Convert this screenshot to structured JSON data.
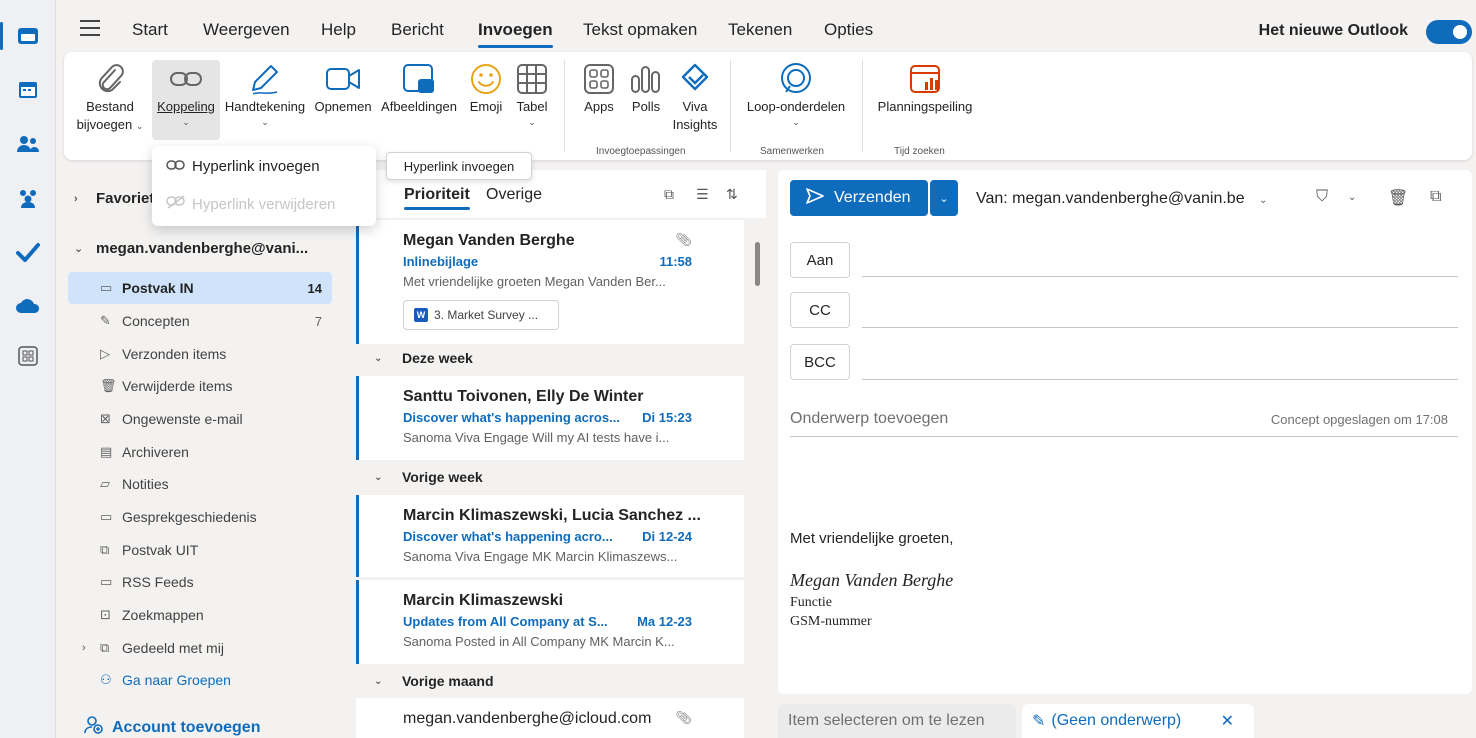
{
  "colors": {
    "accent": "#0f6cbd",
    "selected": "#cfe4fa"
  },
  "menu": {
    "tabs": [
      "Start",
      "Weergeven",
      "Help",
      "Bericht",
      "Invoegen",
      "Tekst opmaken",
      "Tekenen",
      "Opties"
    ],
    "active_tab": "Invoegen",
    "new_outlook_label": "Het nieuwe Outlook"
  },
  "ribbon": {
    "attach": {
      "label1": "Bestand",
      "label2": "bijvoegen",
      "icon": "paperclip-icon"
    },
    "link": {
      "label": "Koppeling",
      "icon": "link-icon"
    },
    "signature": {
      "label": "Handtekening",
      "icon": "pen-icon"
    },
    "record": {
      "label": "Opnemen",
      "icon": "video-icon"
    },
    "images": {
      "label": "Afbeeldingen",
      "icon": "image-icon"
    },
    "emoji": {
      "label": "Emoji",
      "icon": "emoji-icon"
    },
    "table": {
      "label": "Tabel",
      "icon": "table-icon"
    },
    "apps": {
      "label": "Apps",
      "icon": "apps-icon"
    },
    "polls": {
      "label": "Polls",
      "icon": "polls-icon"
    },
    "viva": {
      "label1": "Viva",
      "label2": "Insights",
      "icon": "viva-icon"
    },
    "loop": {
      "label": "Loop-onderdelen",
      "icon": "loop-icon"
    },
    "planning": {
      "label": "Planningspeiling",
      "icon": "calendar-poll-icon"
    },
    "groups": {
      "apps": "Invoegtoepassingen",
      "collab": "Samenwerken",
      "time": "Tijd zoeken"
    }
  },
  "dropdown": {
    "insert_link": "Hyperlink invoegen",
    "remove_link": "Hyperlink verwijderen",
    "tooltip": "Hyperlink invoegen"
  },
  "folders": {
    "favorites": "Favoriet",
    "account": "megan.vandenberghe@vani...",
    "items": [
      {
        "label": "Postvak IN",
        "count": "14"
      },
      {
        "label": "Concepten",
        "count": "7"
      },
      {
        "label": "Verzonden items",
        "count": ""
      },
      {
        "label": "Verwijderde items",
        "count": ""
      },
      {
        "label": "Ongewenste e-mail",
        "count": ""
      },
      {
        "label": "Archiveren",
        "count": ""
      },
      {
        "label": "Notities",
        "count": ""
      },
      {
        "label": "Gesprekgeschiedenis",
        "count": ""
      },
      {
        "label": "Postvak UIT",
        "count": ""
      },
      {
        "label": "RSS Feeds",
        "count": ""
      },
      {
        "label": "Zoekmappen",
        "count": ""
      },
      {
        "label": "Gedeeld met mij",
        "count": ""
      }
    ],
    "groups_link": "Ga naar Groepen",
    "add_account": "Account toevoegen"
  },
  "message_list": {
    "tab_focused": "Prioriteit",
    "tab_other": "Overige",
    "messages": [
      {
        "from": "Megan Vanden Berghe",
        "subject": "Inlinebijlage",
        "time": "11:58",
        "preview": "Met vriendelijke groeten Megan Vanden Ber...",
        "attachment": "3. Market Survey ..."
      },
      {
        "from": "Santtu Toivonen, Elly De Winter",
        "subject": "Discover what's happening acros...",
        "time": "Di 15:23",
        "preview": "Sanoma Viva Engage Will my AI tests have i..."
      },
      {
        "from": "Marcin Klimaszewski, Lucia Sanchez ...",
        "subject": "Discover what's happening acro...",
        "time": "Di 12-24",
        "preview": "Sanoma Viva Engage MK Marcin Klimaszews..."
      },
      {
        "from": "Marcin Klimaszewski",
        "subject": "Updates from All Company at S...",
        "time": "Ma 12-23",
        "preview": "Sanoma Posted in All Company MK Marcin K..."
      },
      {
        "from": "megan.vandenberghe@icloud.com"
      }
    ],
    "sections": [
      "Deze week",
      "Vorige week",
      "Vorige maand"
    ]
  },
  "compose": {
    "send_label": "Verzenden",
    "from_label": "Van: megan.vandenberghe@vanin.be",
    "to_label": "Aan",
    "cc_label": "CC",
    "bcc_label": "BCC",
    "subject_placeholder": "Onderwerp toevoegen",
    "saved_status": "Concept opgeslagen om 17:08",
    "greeting": "Met vriendelijke groeten,",
    "sig_name": "Megan Vanden Berghe",
    "sig_function": "Functie",
    "sig_phone": "GSM-nummer"
  },
  "bottom_tabs": {
    "read_label": "Item selecteren om te lezen",
    "draft_label": "(Geen onderwerp)"
  }
}
